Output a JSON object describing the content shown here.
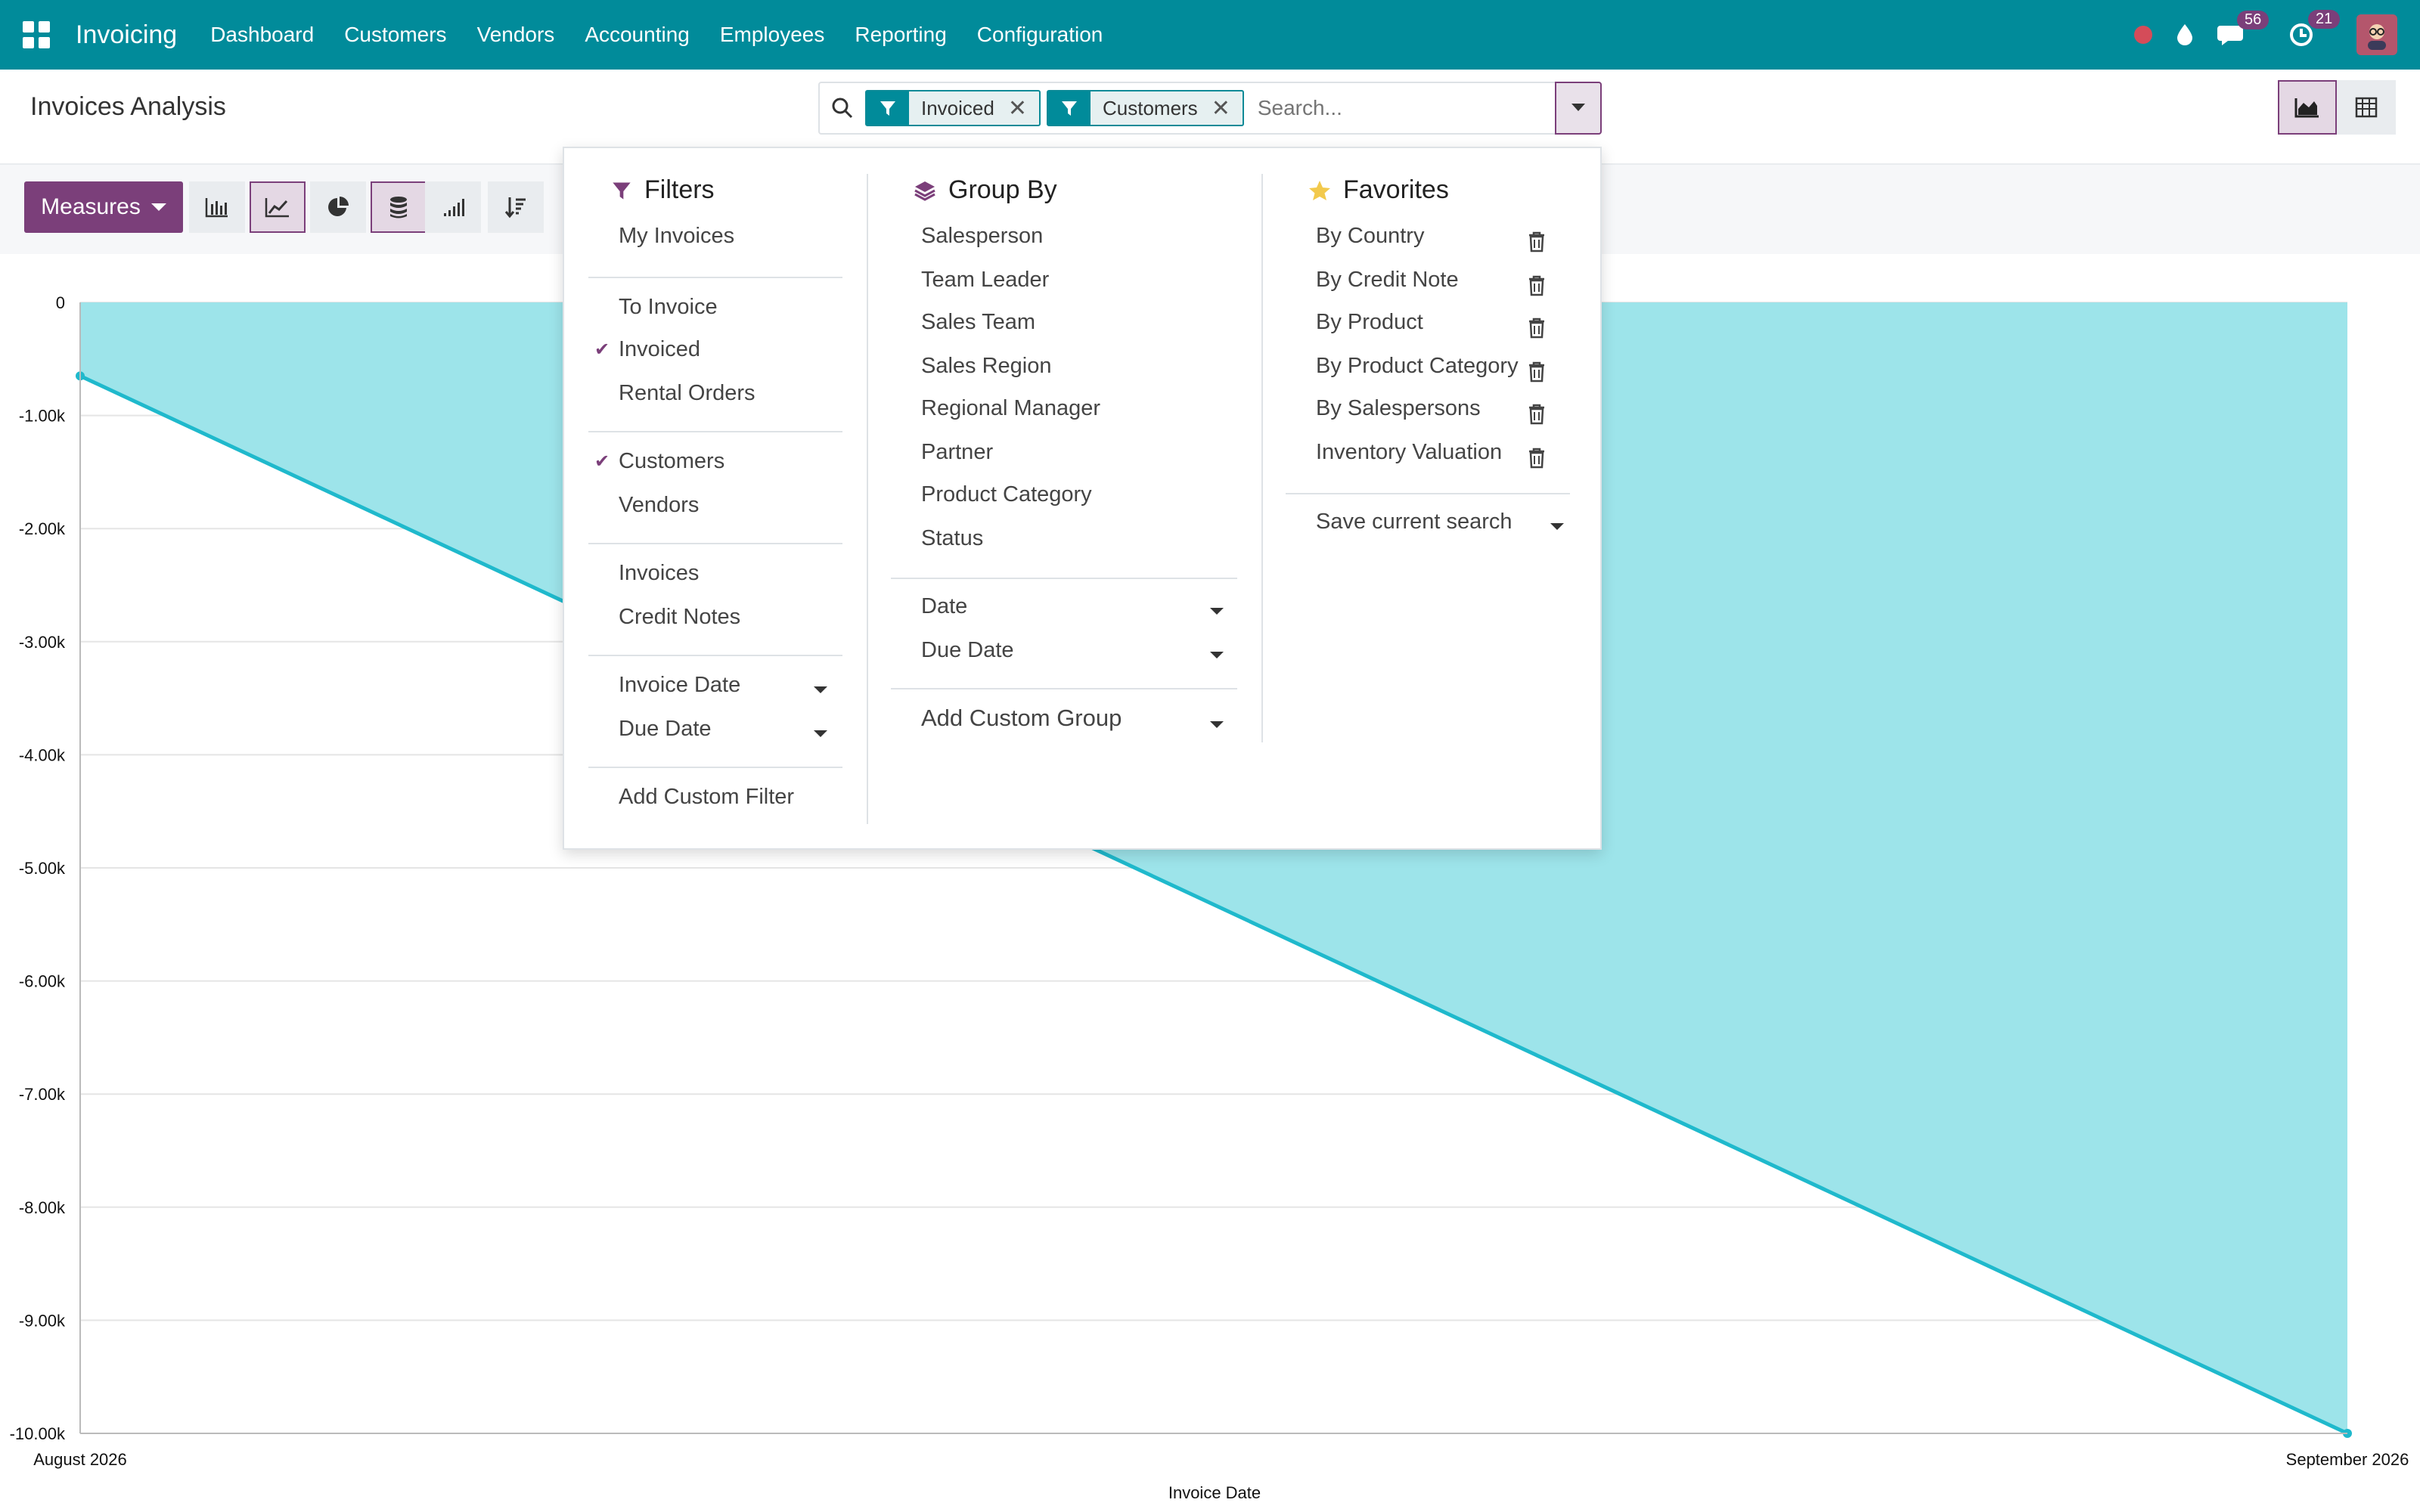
{
  "app": {
    "name": "Invoicing"
  },
  "nav": {
    "menu": [
      "Dashboard",
      "Customers",
      "Vendors",
      "Accounting",
      "Employees",
      "Reporting",
      "Configuration"
    ],
    "chat_badge": "56",
    "activity_badge": "21"
  },
  "page": {
    "title": "Invoices Analysis"
  },
  "search": {
    "facets": [
      "Invoiced",
      "Customers"
    ],
    "placeholder": "Search..."
  },
  "toolbar": {
    "measures_label": "Measures"
  },
  "filters": {
    "title": "Filters",
    "groups": [
      [
        "My Invoices"
      ],
      [
        "To Invoice",
        "Invoiced",
        "Rental Orders"
      ],
      [
        "Customers",
        "Vendors"
      ],
      [
        "Invoices",
        "Credit Notes"
      ],
      [
        "Invoice Date",
        "Due Date"
      ],
      [
        "Add Custom Filter"
      ]
    ],
    "checked": [
      "Invoiced",
      "Customers"
    ]
  },
  "groupby": {
    "title": "Group By",
    "items": [
      "Salesperson",
      "Team Leader",
      "Sales Team",
      "Sales Region",
      "Regional Manager",
      "Partner",
      "Product Category",
      "Status"
    ],
    "date_items": [
      "Date",
      "Due Date"
    ],
    "custom": "Add Custom Group"
  },
  "favorites": {
    "title": "Favorites",
    "items": [
      "By Country",
      "By Credit Note",
      "By Product",
      "By Product Category",
      "By Salespersons",
      "Inventory Valuation"
    ],
    "save": "Save current search"
  },
  "colors": {
    "brand": "#018b9a",
    "accent": "#7b3f7a",
    "series_line": "#1fb9cc",
    "series_fill": "#9de4ea"
  },
  "chart_data": {
    "type": "area",
    "x": [
      "August 2026",
      "September 2026"
    ],
    "series": [
      {
        "values": [
          -650,
          -10000
        ]
      }
    ],
    "xlabel": "Invoice Date",
    "ylabel": "",
    "ylim": [
      -10000,
      0
    ],
    "yticks": [
      "0",
      "-1.00k",
      "-2.00k",
      "-3.00k",
      "-4.00k",
      "-5.00k",
      "-6.00k",
      "-7.00k",
      "-8.00k",
      "-9.00k",
      "-10.00k"
    ],
    "grid": true
  }
}
